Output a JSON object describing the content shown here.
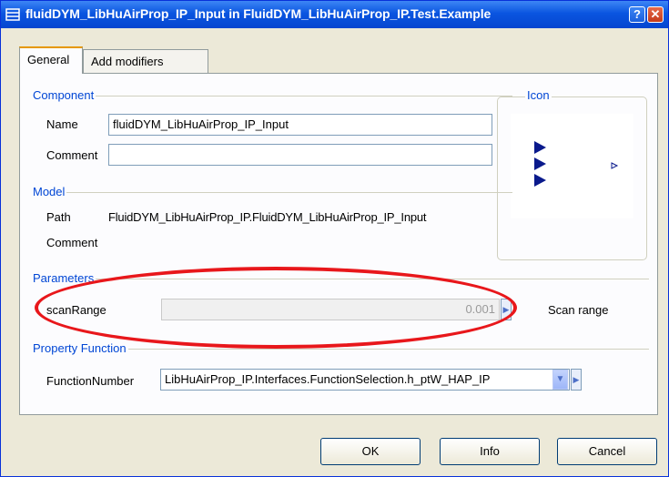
{
  "window": {
    "title": "fluidDYM_LibHuAirProp_IP_Input in FluidDYM_LibHuAirProp_IP.Test.Example",
    "help_button": "?",
    "close_button": "✕"
  },
  "tabs": [
    {
      "label": "General"
    },
    {
      "label": "Add modifiers"
    }
  ],
  "component": {
    "group_label": "Component",
    "name_label": "Name",
    "name_value": "fluidDYM_LibHuAirProp_IP_Input",
    "comment_label": "Comment",
    "comment_value": ""
  },
  "icon_group": {
    "label": "Icon"
  },
  "model": {
    "group_label": "Model",
    "path_label": "Path",
    "path_value": "FluidDYM_LibHuAirProp_IP.FluidDYM_LibHuAirProp_IP_Input",
    "comment_label": "Comment"
  },
  "parameters": {
    "group_label": "Parameters",
    "scan_range_label": "scanRange",
    "scan_range_value": "0.001",
    "scan_range_description": "Scan range"
  },
  "property_function": {
    "group_label": "Property Function",
    "function_number_label": "FunctionNumber",
    "function_number_value": "LibHuAirProp_IP.Interfaces.FunctionSelection.h_ptW_HAP_IP"
  },
  "buttons": {
    "ok": "OK",
    "info": "Info",
    "cancel": "Cancel"
  },
  "colors": {
    "group_label": "#0046d5",
    "highlight_ellipse": "#e8171b",
    "title_bar": "#0a55e0"
  }
}
